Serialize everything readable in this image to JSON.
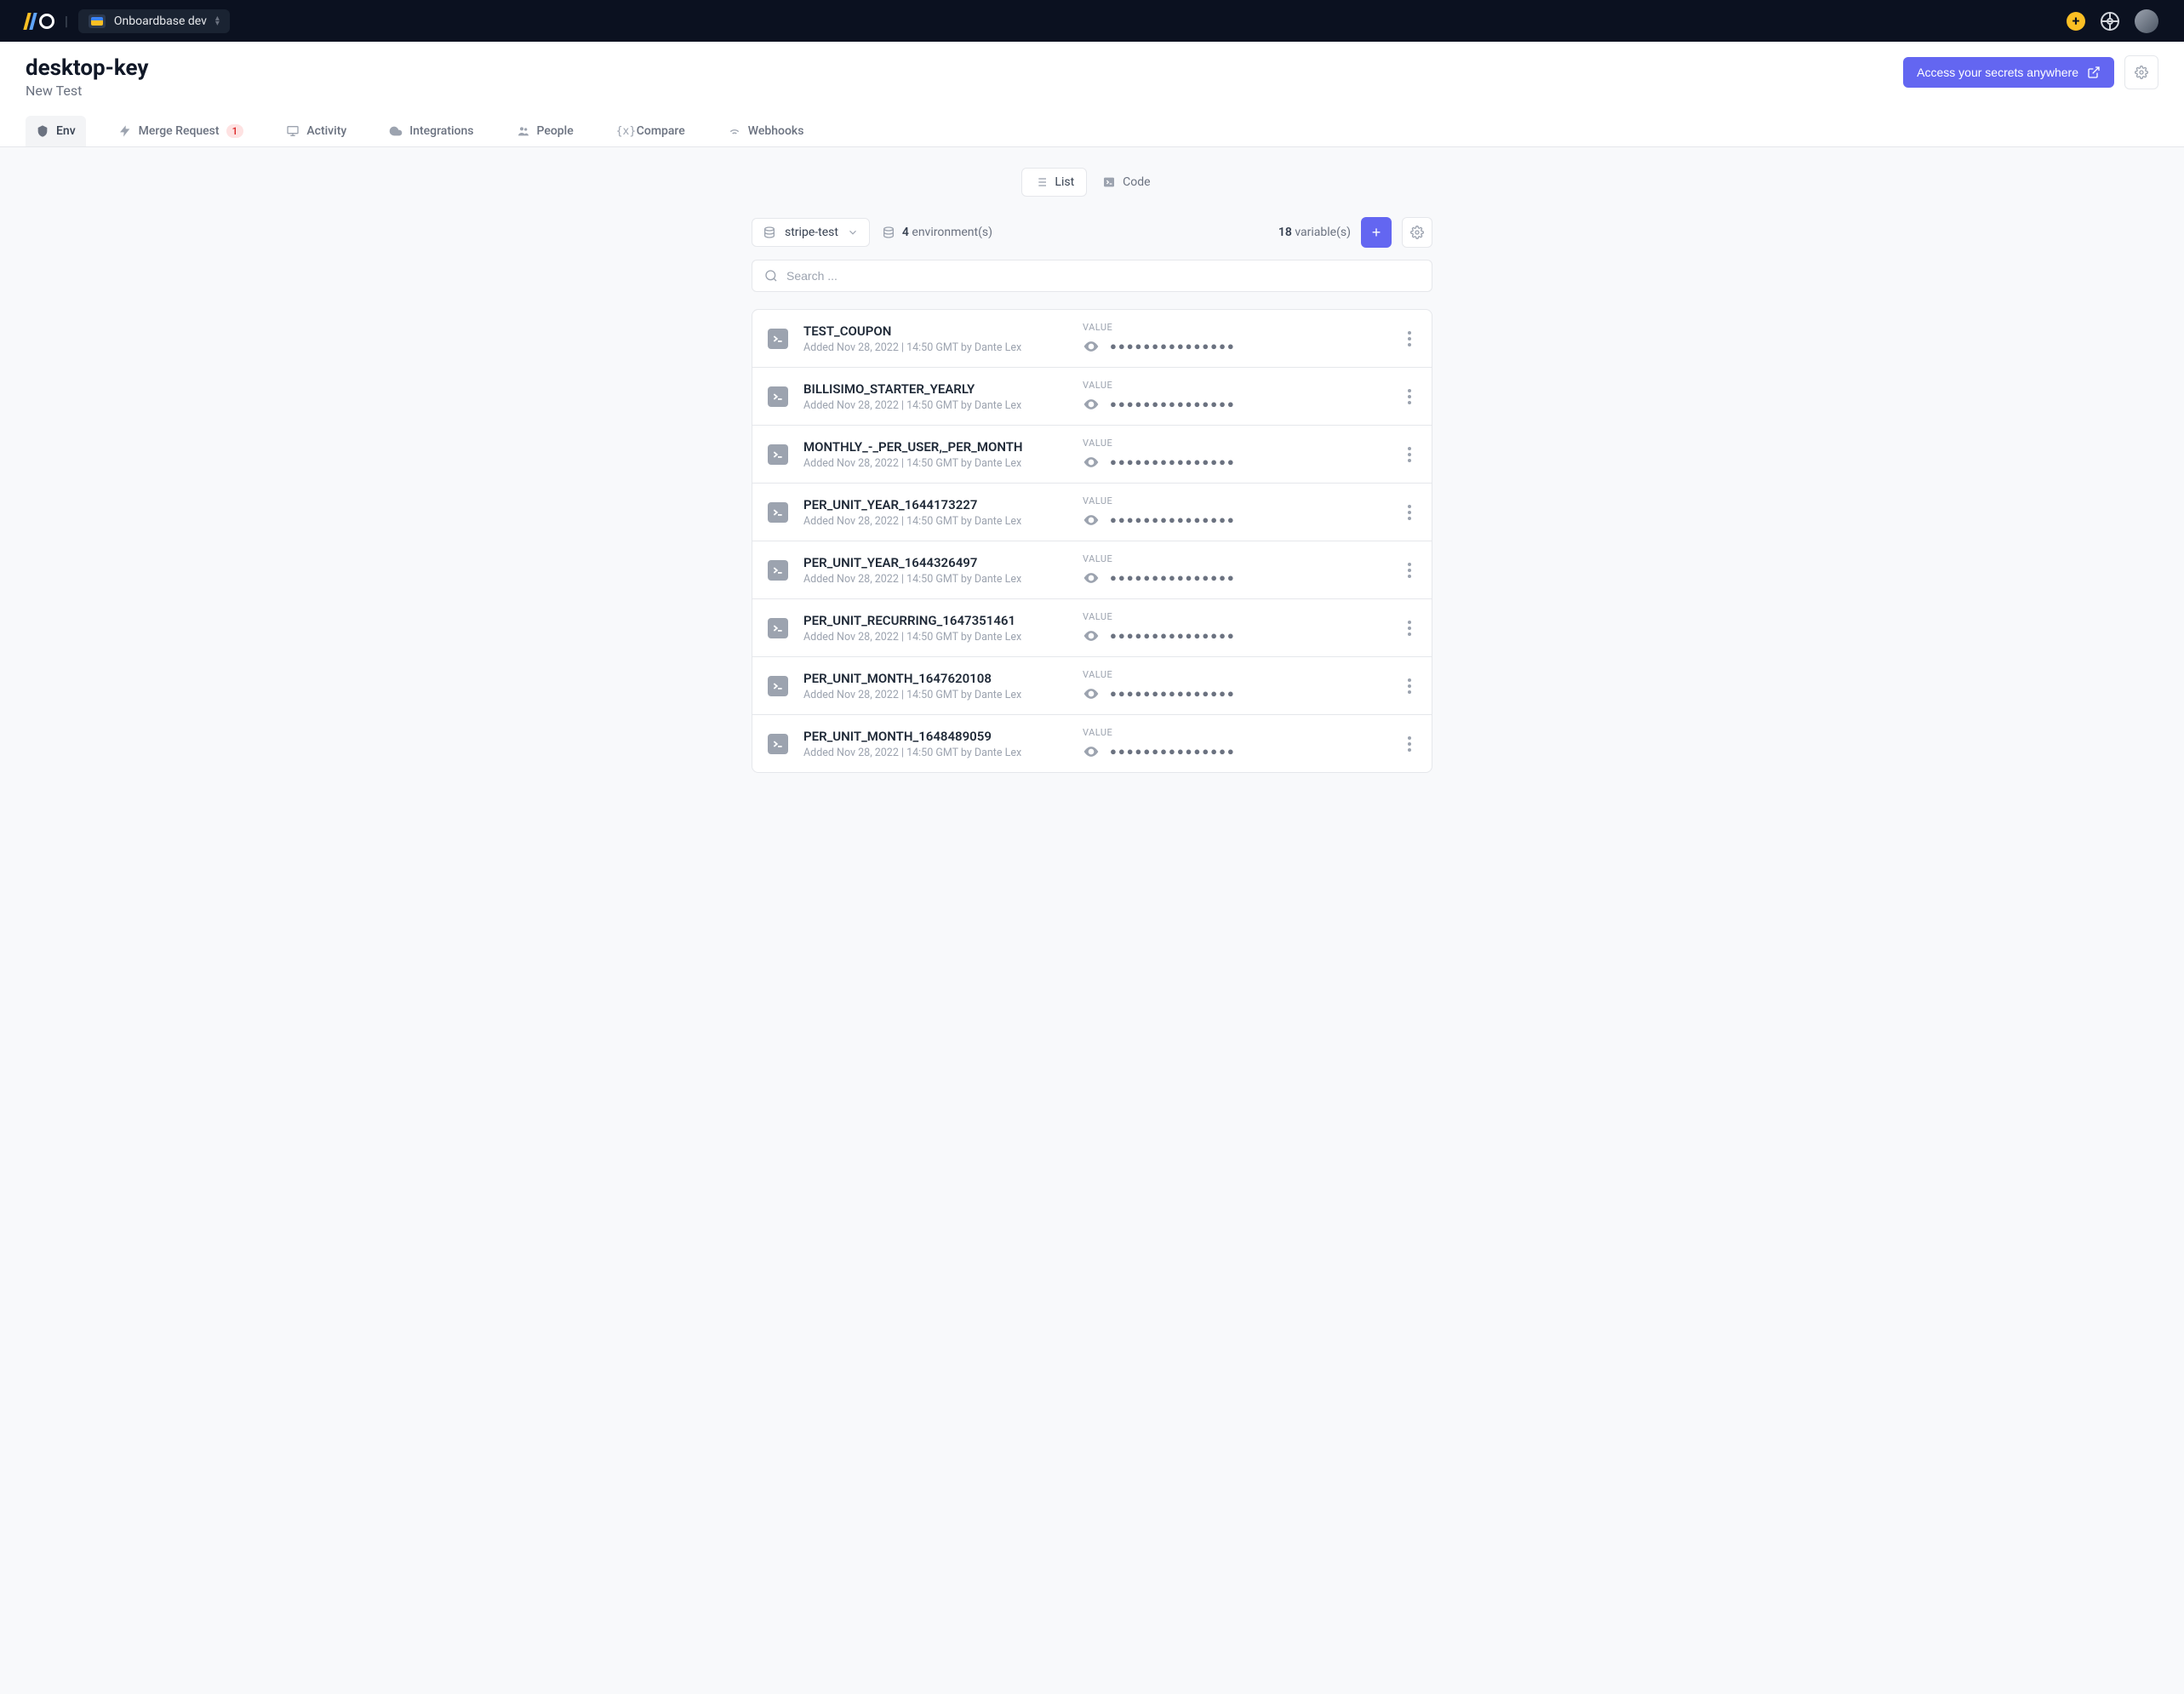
{
  "org": {
    "name": "Onboardbase dev"
  },
  "header": {
    "title": "desktop-key",
    "subtitle": "New Test",
    "access_btn": "Access your secrets anywhere"
  },
  "tabs": {
    "env": "Env",
    "merge": "Merge Request",
    "merge_badge": "1",
    "activity": "Activity",
    "integrations": "Integrations",
    "people": "People",
    "compare": "Compare",
    "webhooks": "Webhooks"
  },
  "view": {
    "list": "List",
    "code": "Code"
  },
  "env": {
    "selected": "stripe-test",
    "count": "4",
    "count_label": "environment(s)",
    "var_count": "18",
    "var_label": "variable(s)"
  },
  "search": {
    "placeholder": "Search ..."
  },
  "value_label": "VALUE",
  "masked": "●●●●●●●●●●●●●●●",
  "rows": [
    {
      "key": "TEST_COUPON",
      "meta": "Added Nov 28, 2022 | 14:50 GMT by Dante Lex"
    },
    {
      "key": "BILLISIMO_STARTER_YEARLY",
      "meta": "Added Nov 28, 2022 | 14:50 GMT by Dante Lex"
    },
    {
      "key": "MONTHLY_-_PER_USER,_PER_MONTH",
      "meta": "Added Nov 28, 2022 | 14:50 GMT by Dante Lex"
    },
    {
      "key": "PER_UNIT_YEAR_1644173227",
      "meta": "Added Nov 28, 2022 | 14:50 GMT by Dante Lex"
    },
    {
      "key": "PER_UNIT_YEAR_1644326497",
      "meta": "Added Nov 28, 2022 | 14:50 GMT by Dante Lex"
    },
    {
      "key": "PER_UNIT_RECURRING_1647351461",
      "meta": "Added Nov 28, 2022 | 14:50 GMT by Dante Lex"
    },
    {
      "key": "PER_UNIT_MONTH_1647620108",
      "meta": "Added Nov 28, 2022 | 14:50 GMT by Dante Lex"
    },
    {
      "key": "PER_UNIT_MONTH_1648489059",
      "meta": "Added Nov 28, 2022 | 14:50 GMT by Dante Lex"
    }
  ]
}
